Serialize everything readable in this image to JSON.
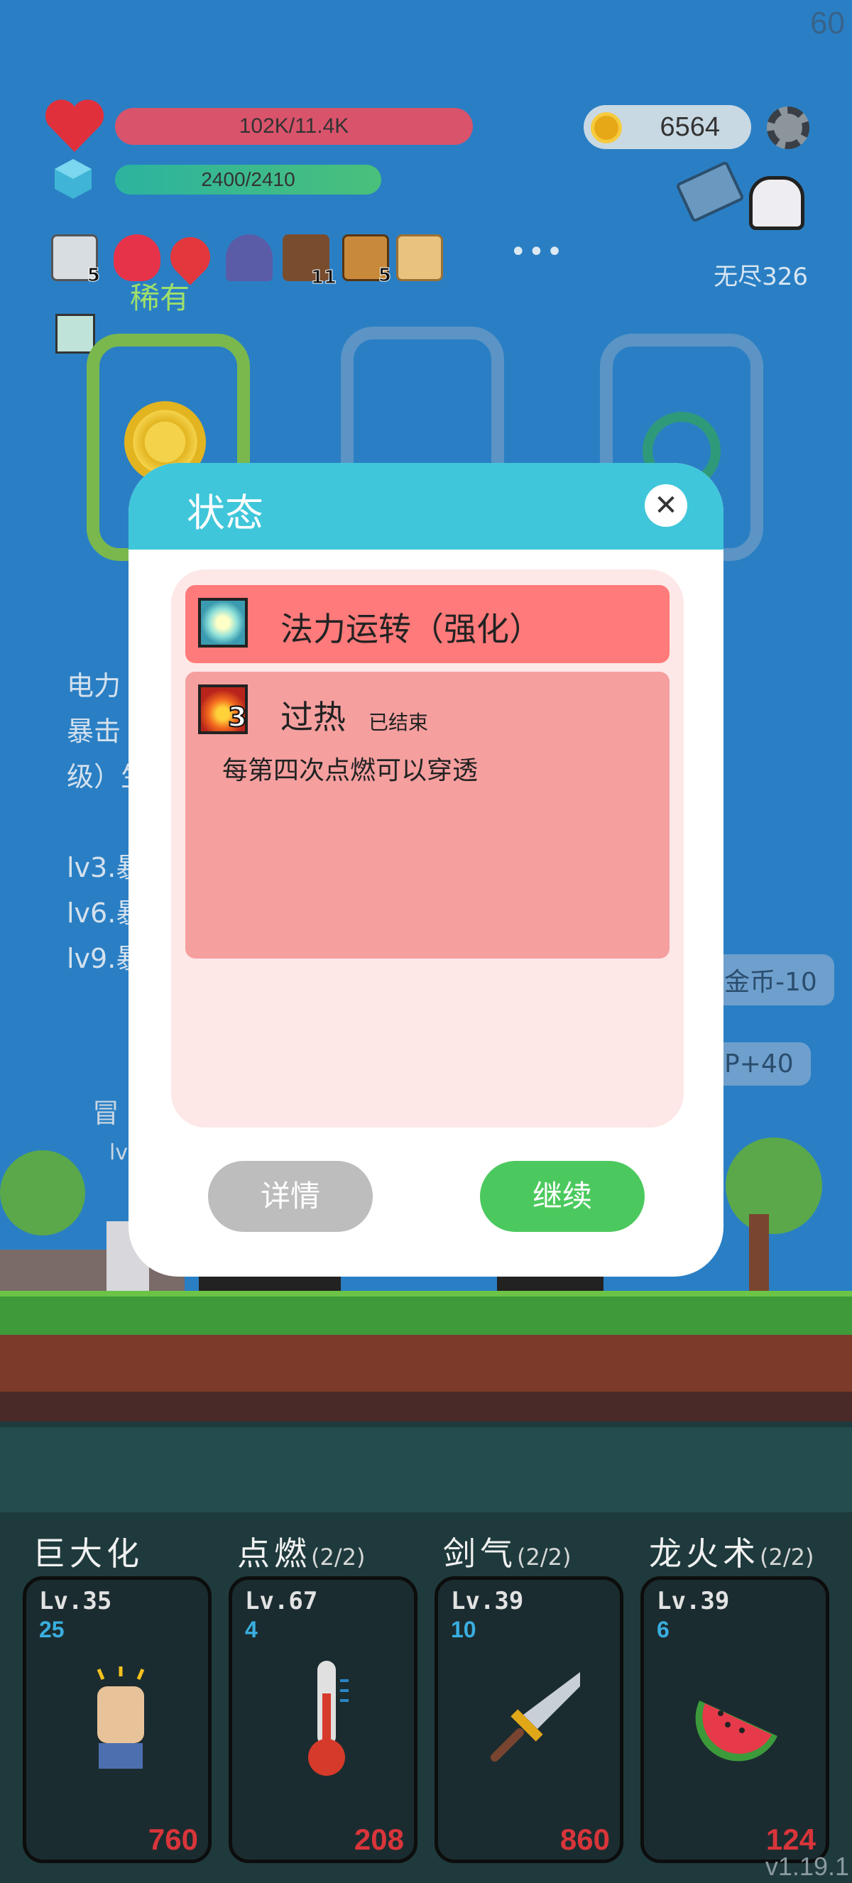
{
  "fps": "60",
  "hp": {
    "text": "102K/11.4K"
  },
  "mp": {
    "text": "2400/2410"
  },
  "coins": "6564",
  "mode": "无尽326",
  "icons": [
    {
      "name": "mail-icon",
      "badge": "5"
    },
    {
      "name": "flame-icon",
      "badge": ""
    },
    {
      "name": "map-pin-icon",
      "badge": ""
    },
    {
      "name": "wizard-hat-icon",
      "badge": ""
    },
    {
      "name": "pirate-ship-icon",
      "badge": "11"
    },
    {
      "name": "book-icon",
      "badge": "5"
    },
    {
      "name": "scroll-icon",
      "badge": ""
    }
  ],
  "more": "•••",
  "rarity": "稀有",
  "background_text": {
    "l1": "电力",
    "l2": "暴击",
    "l3": "级）生",
    "l4": "lv3.暴",
    "l5": "lv6.暴",
    "l6": "lv9.暴",
    "side1": "金币-10",
    "side2": "P+40",
    "hero": "冒",
    "hero_lv": "lv"
  },
  "modal": {
    "title": "状态",
    "close": "✕",
    "buffs": [
      {
        "name": "法力运转（强化）",
        "icon": "mana-bulb-icon"
      },
      {
        "name": "过热",
        "icon": "fire-icon",
        "stack": "3",
        "tag": "已结束",
        "desc": "每第四次点燃可以穿透"
      }
    ],
    "detail_btn": "详情",
    "continue_btn": "继续"
  },
  "skills": [
    {
      "title": "巨大化",
      "uses": "",
      "level": "Lv.35",
      "count": "25",
      "cost": "760",
      "icon": "fist-icon"
    },
    {
      "title": "点燃",
      "uses": "(2/2)",
      "level": "Lv.67",
      "count": "4",
      "cost": "208",
      "icon": "thermometer-icon"
    },
    {
      "title": "剑气",
      "uses": "(2/2)",
      "level": "Lv.39",
      "count": "10",
      "cost": "860",
      "icon": "sword-icon"
    },
    {
      "title": "龙火术",
      "uses": "(2/2)",
      "level": "Lv.39",
      "count": "6",
      "cost": "124",
      "icon": "watermelon-icon"
    }
  ],
  "version": "v1.19.1",
  "colors": {
    "hp": "#d9536b",
    "modal_header": "#3fc6da",
    "buff_active": "#ff7a7a",
    "buff_ended": "#f59f9f",
    "continue": "#4cc95e",
    "detail": "#bdbdbd"
  }
}
